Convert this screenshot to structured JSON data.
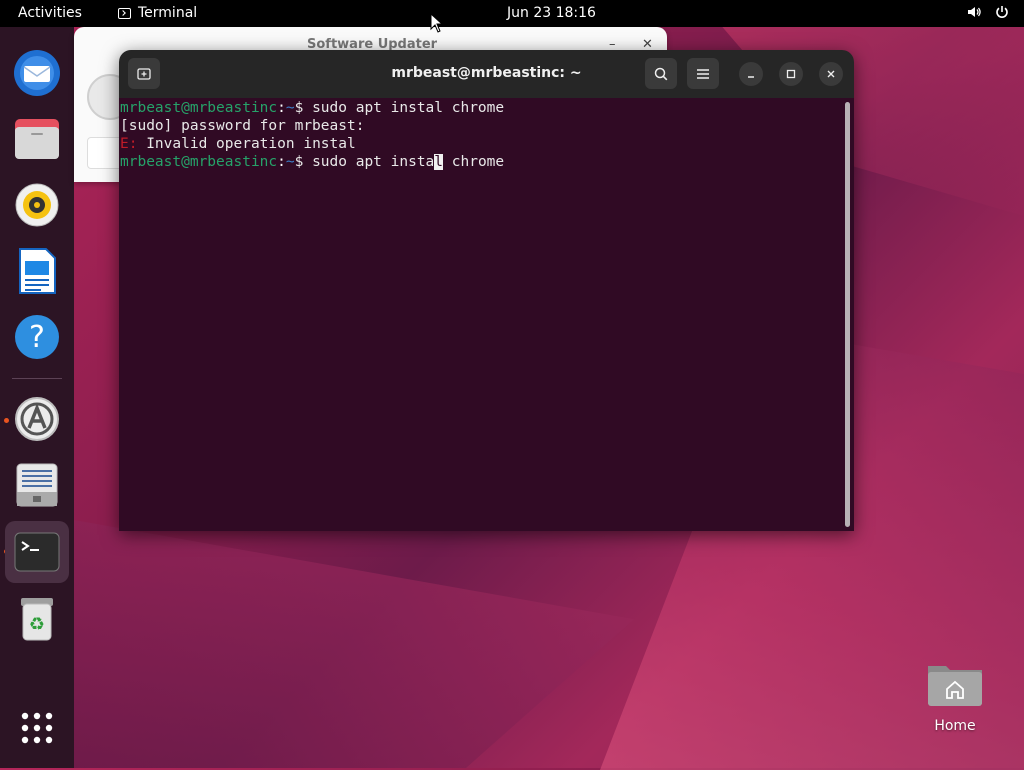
{
  "topbar": {
    "activities": "Activities",
    "app_name": "Terminal",
    "clock": "Jun 23  18:16"
  },
  "dock": {
    "items": [
      {
        "name": "Thunderbird Mail",
        "icon": "mail-icon"
      },
      {
        "name": "Files",
        "icon": "files-icon"
      },
      {
        "name": "Rhythmbox",
        "icon": "music-icon"
      },
      {
        "name": "LibreOffice Writer",
        "icon": "writer-icon"
      },
      {
        "name": "Help",
        "icon": "help-icon"
      },
      {
        "name": "Software Updater",
        "icon": "software-updater-icon",
        "running": true
      },
      {
        "name": "Text Editor",
        "icon": "text-editor-icon"
      },
      {
        "name": "Terminal",
        "icon": "terminal-icon",
        "running": true,
        "focused": true
      },
      {
        "name": "Trash",
        "icon": "trash-icon"
      },
      {
        "name": "Show Applications",
        "icon": "app-grid-icon"
      }
    ]
  },
  "updater_window": {
    "title": "Software Updater"
  },
  "terminal": {
    "title": "mrbeast@mrbeastinc: ~",
    "lines": [
      {
        "user": "mrbeast@mrbeastinc",
        "sep": ":",
        "path": "~",
        "cmd": "$ sudo apt instal chrome"
      },
      {
        "text": "[sudo] password for mrbeast:"
      },
      {
        "err_prefix": "E:",
        "text": " Invalid operation instal"
      },
      {
        "user": "mrbeast@mrbeastinc",
        "sep": ":",
        "path": "~",
        "cmd_before": "$ sudo apt insta",
        "cursor": "l",
        "cmd_after": " chrome"
      }
    ]
  },
  "desktop": {
    "home_label": "Home"
  },
  "colors": {
    "terminal_bg": "#300a24",
    "prompt_user": "#26a269",
    "prompt_path": "#3c7ec8",
    "error": "#c01c28",
    "accent": "#e95420"
  }
}
